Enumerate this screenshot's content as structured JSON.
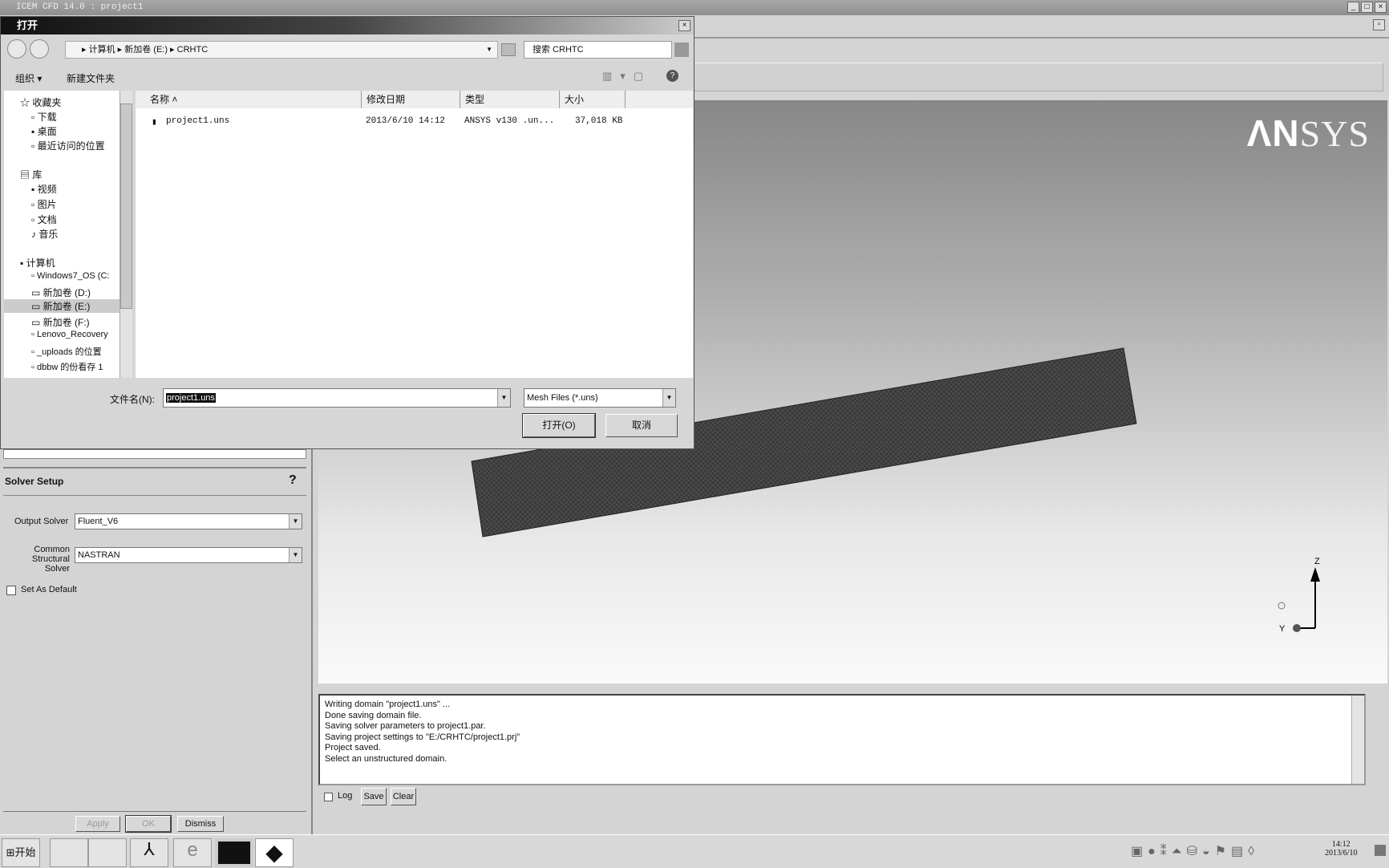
{
  "app": {
    "title": "ICEM CFD 14.0 : project1",
    "logo": "ANSYS"
  },
  "dialog": {
    "title": "打开",
    "breadcrumb": [
      "计算机",
      "新加卷 (E:)",
      "CRHTC"
    ],
    "search_placeholder": "搜索 CRHTC",
    "organize": "组织 ▾",
    "new_folder": "新建文件夹",
    "tree": [
      {
        "label": "收藏夹"
      },
      {
        "label": "下载"
      },
      {
        "label": "桌面"
      },
      {
        "label": "最近访问的位置"
      },
      {
        "label": "库"
      },
      {
        "label": "视频"
      },
      {
        "label": "图片"
      },
      {
        "label": "文档"
      },
      {
        "label": "音乐"
      },
      {
        "label": "计算机"
      },
      {
        "label": "Windows7_OS (C:"
      },
      {
        "label": "新加卷 (D:)"
      },
      {
        "label": "新加卷 (E:)"
      },
      {
        "label": "新加卷 (F:)"
      },
      {
        "label": "Lenovo_Recovery"
      },
      {
        "label": "_uploads 的位置"
      },
      {
        "label": "dbbw 的份看存 1"
      }
    ],
    "columns": [
      "名称",
      "修改日期",
      "类型",
      "大小"
    ],
    "files": [
      {
        "name": "project1.uns",
        "date": "2013/6/10 14:12",
        "type": "ANSYS v130 .un...",
        "size": "37,018 KB"
      }
    ],
    "filename_label": "文件名(N):",
    "filename_value": "project1.uns",
    "filter": "Mesh Files (*.uns)",
    "open": "打开(O)",
    "cancel": "取消"
  },
  "solver": {
    "title": "Solver Setup",
    "output_label": "Output Solver",
    "output_value": "Fluent_V6",
    "common_label1": "Common",
    "common_label2": "Structural Solver",
    "common_value": "NASTRAN",
    "default_label": "Set As Default",
    "apply": "Apply",
    "ok": "OK",
    "dismiss": "Dismiss"
  },
  "messages": {
    "lines": [
      "Writing domain \"project1.uns\" ...",
      "Done saving domain file.",
      "Saving solver parameters to project1.par.",
      "Saving project settings to \"E:/CRHTC/project1.prj\"",
      "Project saved.",
      "Select an unstructured domain."
    ],
    "log": "Log",
    "save": "Save",
    "clear": "Clear"
  },
  "axis": {
    "z": "Z",
    "y": "Y"
  },
  "taskbar": {
    "start": "开始",
    "time": "14:12",
    "date": "2013/6/10"
  }
}
